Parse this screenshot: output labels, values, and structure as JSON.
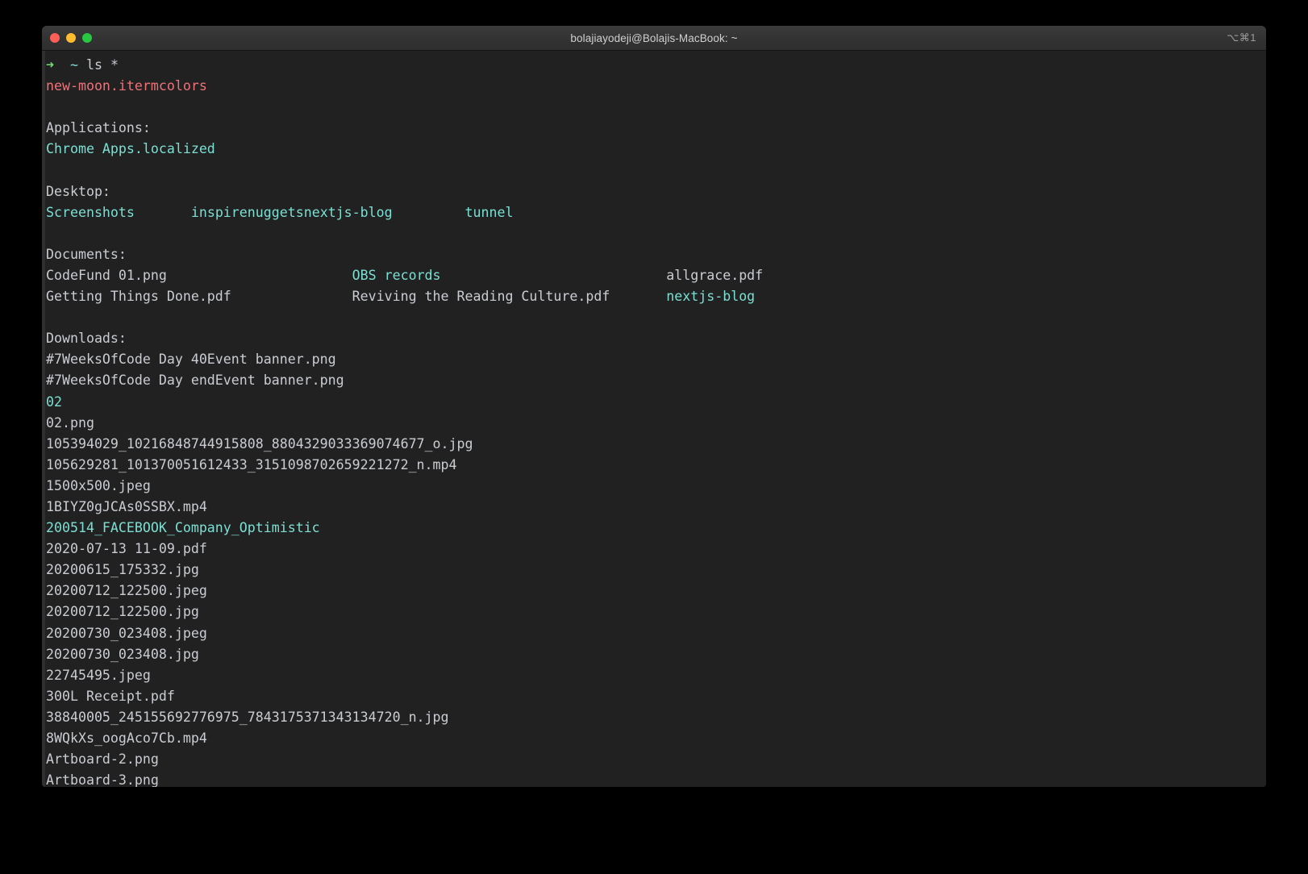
{
  "window": {
    "title": "bolajiayodeji@Bolajis-MacBook: ~",
    "shortcut": "⌥⌘1",
    "background_color": "#212121",
    "titlebar_color": "#333333"
  },
  "colors": {
    "default_text": "#c9cdd2",
    "directory": "#7ddfd3",
    "red_file": "#f07178",
    "prompt_arrow": "#77dd77",
    "prompt_path": "#7ddfd3",
    "close_button": "#ff5f57",
    "minimize_button": "#febc2e",
    "maximize_button": "#28c840"
  },
  "prompt": {
    "arrow": "➜",
    "path": "~",
    "command": "ls *"
  },
  "output": {
    "root_file": "new-moon.itermcolors",
    "sections": [
      {
        "heading": "Applications:",
        "rows": [
          [
            {
              "text": "Chrome Apps.localized",
              "color": "dir"
            }
          ]
        ]
      },
      {
        "heading": "Desktop:",
        "rows": [
          [
            {
              "text": "Screenshots",
              "color": "dir"
            },
            {
              "text": "inspirenuggets",
              "color": "dir"
            },
            {
              "text": "nextjs-blog",
              "color": "dir"
            },
            {
              "text": "tunnel",
              "color": "dir"
            }
          ]
        ]
      },
      {
        "heading": "Documents:",
        "rows": [
          [
            {
              "text": "CodeFund 01.png",
              "color": "default"
            },
            {
              "text": "OBS records",
              "color": "dir"
            },
            {
              "text": "allgrace.pdf",
              "color": "default"
            }
          ],
          [
            {
              "text": "Getting Things Done.pdf",
              "color": "default"
            },
            {
              "text": "Reviving the Reading Culture.pdf",
              "color": "default"
            },
            {
              "text": "nextjs-blog",
              "color": "dir"
            }
          ]
        ]
      },
      {
        "heading": "Downloads:",
        "rows": [
          [
            {
              "text": "#7WeeksOfCode Day 40Event banner.png",
              "color": "default"
            }
          ],
          [
            {
              "text": "#7WeeksOfCode Day endEvent banner.png",
              "color": "default"
            }
          ],
          [
            {
              "text": "02",
              "color": "dir"
            }
          ],
          [
            {
              "text": "02.png",
              "color": "default"
            }
          ],
          [
            {
              "text": "105394029_10216848744915808_8804329033369074677_o.jpg",
              "color": "default"
            }
          ],
          [
            {
              "text": "105629281_101370051612433_3151098702659221272_n.mp4",
              "color": "default"
            }
          ],
          [
            {
              "text": "1500x500.jpeg",
              "color": "default"
            }
          ],
          [
            {
              "text": "1BIYZ0gJCAs0SSBX.mp4",
              "color": "default"
            }
          ],
          [
            {
              "text": "200514_FACEBOOK_Company_Optimistic",
              "color": "dir"
            }
          ],
          [
            {
              "text": "2020-07-13 11-09.pdf",
              "color": "default"
            }
          ],
          [
            {
              "text": "20200615_175332.jpg",
              "color": "default"
            }
          ],
          [
            {
              "text": "20200712_122500.jpeg",
              "color": "default"
            }
          ],
          [
            {
              "text": "20200712_122500.jpg",
              "color": "default"
            }
          ],
          [
            {
              "text": "20200730_023408.jpeg",
              "color": "default"
            }
          ],
          [
            {
              "text": "20200730_023408.jpg",
              "color": "default"
            }
          ],
          [
            {
              "text": "22745495.jpeg",
              "color": "default"
            }
          ],
          [
            {
              "text": "300L Receipt.pdf",
              "color": "default"
            }
          ],
          [
            {
              "text": "38840005_245155692776975_7843175371343134720_n.jpg",
              "color": "default"
            }
          ],
          [
            {
              "text": "8WQkXs_oogAco7Cb.mp4",
              "color": "default"
            }
          ],
          [
            {
              "text": "Artboard-2.png",
              "color": "default"
            }
          ],
          [
            {
              "text": "Artboard-3.png",
              "color": "default"
            }
          ]
        ]
      }
    ]
  }
}
